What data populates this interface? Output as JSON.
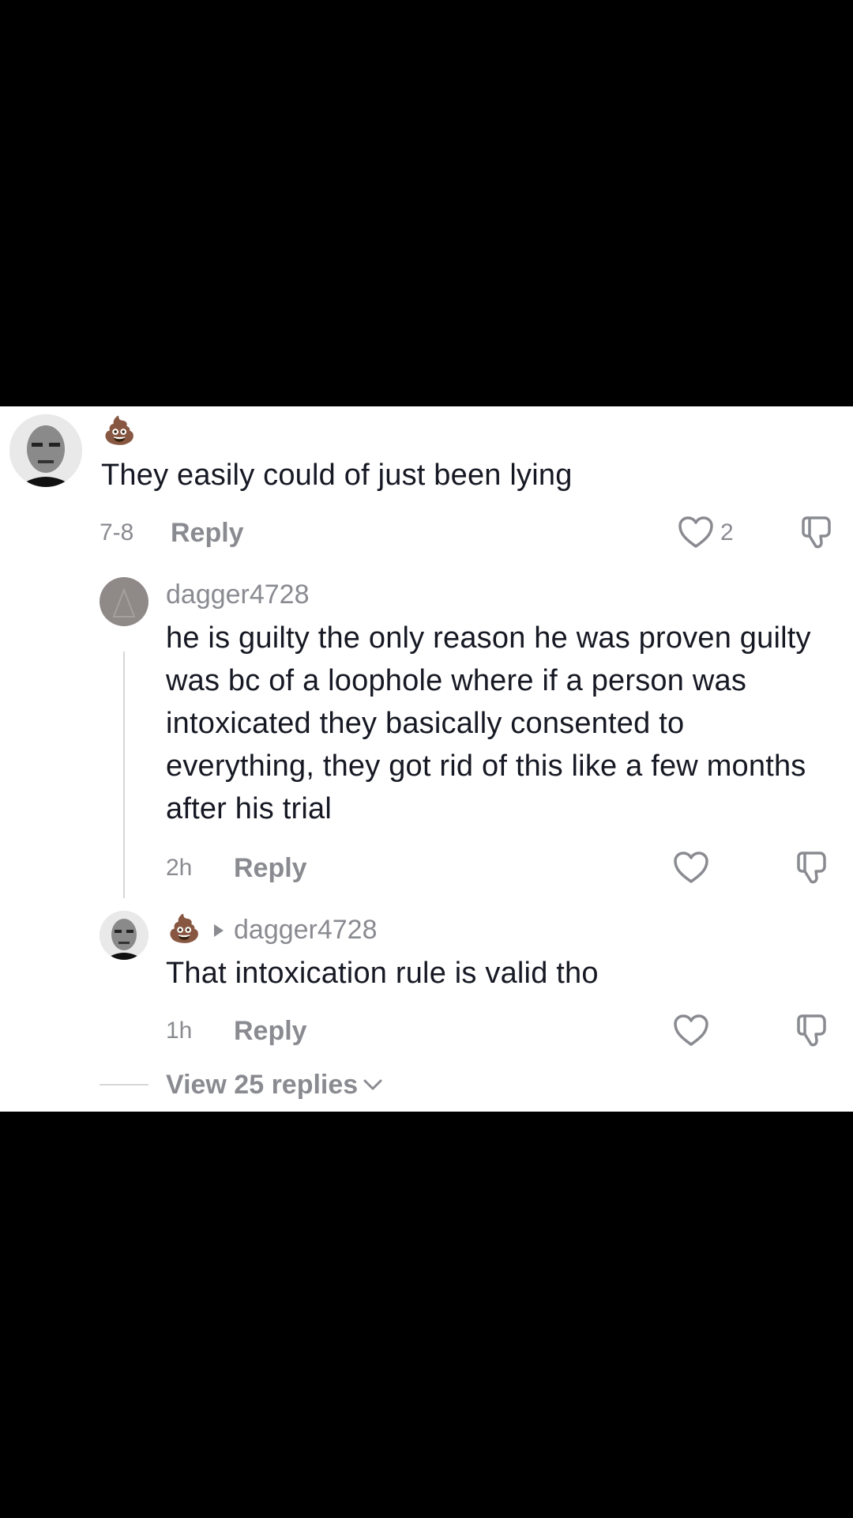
{
  "comments": {
    "top": {
      "username_emoji": "💩",
      "text": "They easily could of just been lying",
      "date": "7-8",
      "reply_label": "Reply",
      "like_count": "2"
    },
    "reply1": {
      "username": "dagger4728",
      "text": "he is guilty the only reason he was proven guilty was bc of a loophole where if a person was intoxicated they basically consented to everything, they got rid of this like a few months after his trial",
      "time": "2h",
      "reply_label": "Reply"
    },
    "reply2": {
      "username_emoji": "💩",
      "reply_to": "dagger4728",
      "text": "That intoxication rule is valid tho",
      "time": "1h",
      "reply_label": "Reply"
    },
    "view_more": "View 25 replies"
  },
  "icons": {
    "like": "heart-outline-icon",
    "dislike": "thumbs-down-icon",
    "expand": "chevron-down-icon",
    "reply_arrow": "triangle-right-icon"
  },
  "colors": {
    "text_primary": "#161823",
    "text_secondary": "#8a8b91",
    "background": "#ffffff"
  }
}
